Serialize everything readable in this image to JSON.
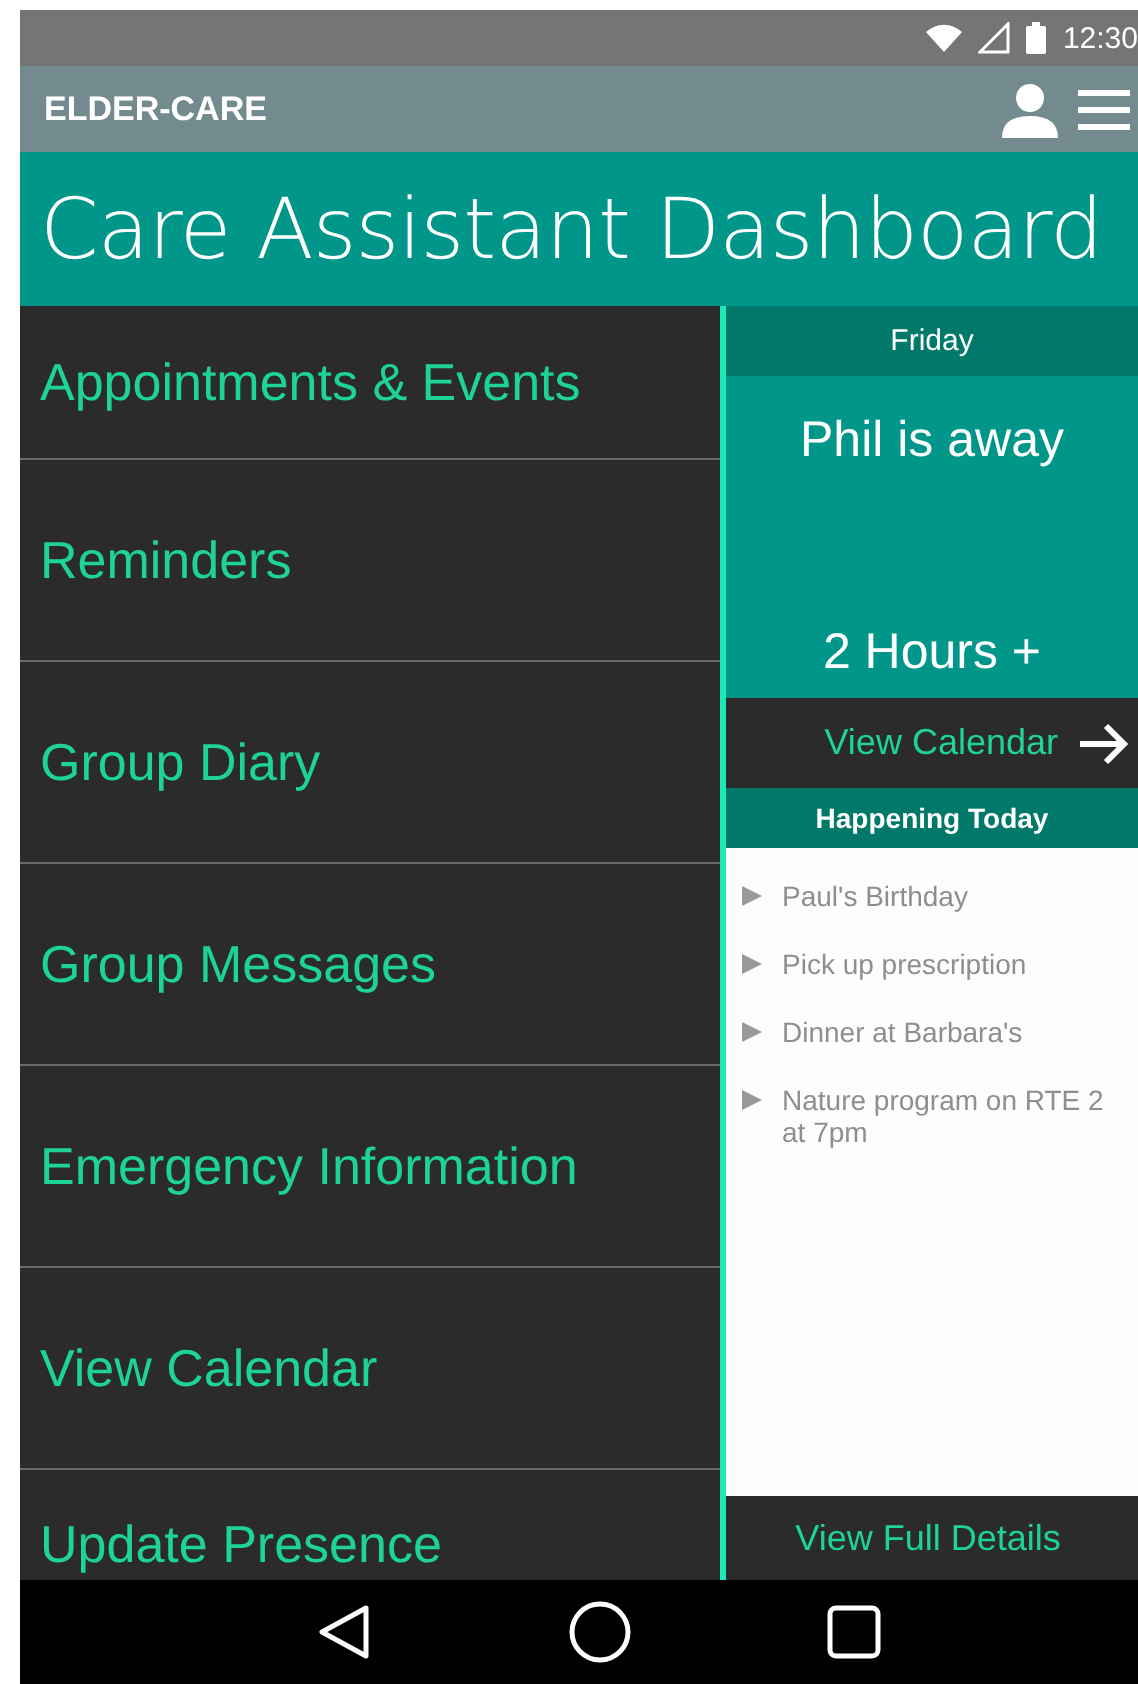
{
  "status_bar": {
    "time": "12:30"
  },
  "app_bar": {
    "title": "ELDER-CARE"
  },
  "header": {
    "title": "Care Assistant Dashboard"
  },
  "menu": [
    {
      "label": "Appointments & Events"
    },
    {
      "label": "Reminders"
    },
    {
      "label": "Group Diary"
    },
    {
      "label": "Group Messages"
    },
    {
      "label": "Emergency Information"
    },
    {
      "label": "View Calendar"
    },
    {
      "label": "Update Presence"
    }
  ],
  "presence": {
    "day": "Friday",
    "status": "Phil is away",
    "duration": "2 Hours +",
    "link": "View Calendar"
  },
  "today": {
    "title": "Happening Today",
    "items": [
      "Paul's Birthday",
      "Pick up prescription",
      "Dinner at Barbara's",
      "Nature program on RTE 2 at 7pm"
    ],
    "link": "View Full Details"
  }
}
